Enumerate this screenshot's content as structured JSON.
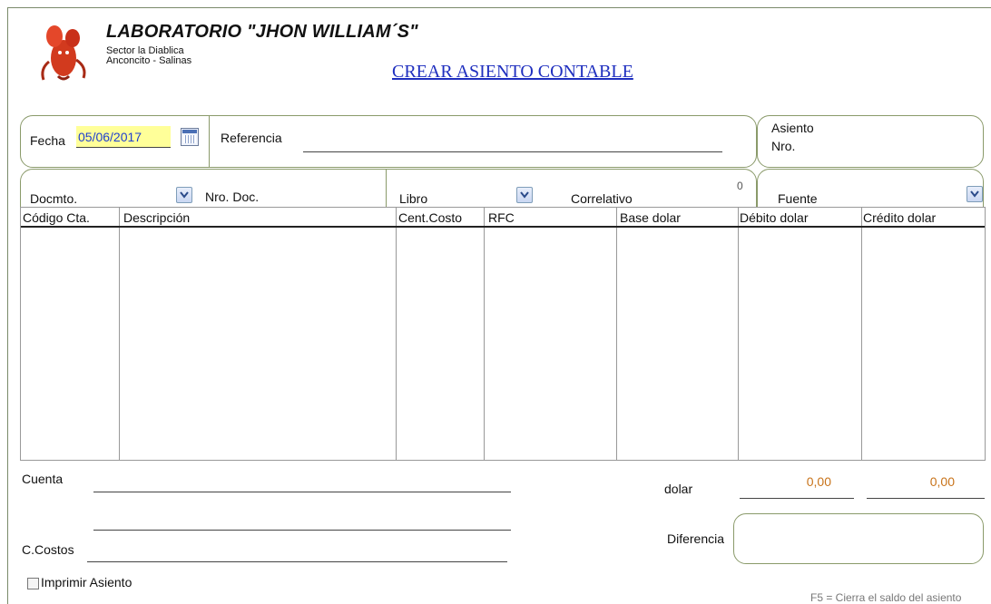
{
  "header": {
    "company": "LABORATORIO  \"JHON WILLIAM´S\"",
    "address_line1": "Sector la Diablica",
    "address_line2": "Anconcito - Salinas",
    "page_title": "CREAR ASIENTO CONTABLE"
  },
  "form": {
    "fecha_label": "Fecha",
    "fecha_value": "05/06/2017",
    "referencia_label": "Referencia",
    "referencia_value": "",
    "asiento_label1": "Asiento",
    "asiento_label2": "Nro.",
    "docmto_label": "Docmto.",
    "nro_doc_label": "Nro. Doc.",
    "libro_label": "Libro",
    "correlativo_label": "Correlativo",
    "correlativo_value": "0",
    "fuente_label": "Fuente"
  },
  "table": {
    "columns": [
      "Código Cta.",
      "Descripción",
      "Cent.Costo",
      "RFC",
      "Base dolar",
      "Débito dolar",
      "Crédito dolar"
    ],
    "rows": []
  },
  "footer": {
    "cuenta_label": "Cuenta",
    "ccostos_label": "C.Costos",
    "dolar_label": "dolar",
    "debito_total": "0,00",
    "credito_total": "0,00",
    "diferencia_label": "Diferencia",
    "imprimir_label": "Imprimir Asiento",
    "f5_note": "F5 =  Cierra el  saldo del asiento"
  },
  "colors": {
    "accent_link": "#1f2fbf",
    "border_green": "#8a9a6a",
    "amount_orange": "#c8731a",
    "date_highlight": "#ffff99"
  },
  "icons": [
    "lobster-logo-icon",
    "calendar-icon",
    "chevron-down-icon"
  ]
}
